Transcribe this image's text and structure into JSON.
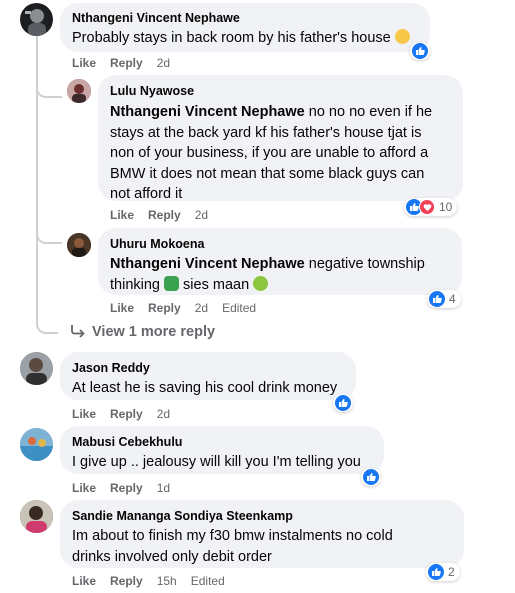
{
  "comments": [
    {
      "name": "Nthangeni Vincent Nephawe",
      "text": "Probably stays in back room by his father's house",
      "emoji": "thinking-face-emoji",
      "actions": {
        "like": "Like",
        "reply": "Reply",
        "time": "2d"
      },
      "reactions": {
        "types": [
          "like"
        ],
        "count": ""
      }
    },
    {
      "name": "Lulu Nyawose",
      "mention": "Nthangeni Vincent Nephawe",
      "lines": [
        "no no no even if he",
        "stays at the back yard kf his father's house tjat is",
        "non of your business, if you are unable to afford a",
        "BMW it does not mean that some black guys can",
        "not afford it"
      ],
      "actions": {
        "like": "Like",
        "reply": "Reply",
        "time": "2d"
      },
      "reactions": {
        "types": [
          "like",
          "love"
        ],
        "count": "10"
      }
    },
    {
      "name": "Uhuru Mokoena",
      "mention": "Nthangeni Vincent Nephawe",
      "line1_rest": "negative township",
      "line2_a": "thinking",
      "line2_b": "sies maan",
      "actions": {
        "like": "Like",
        "reply": "Reply",
        "time": "2d",
        "edited": "Edited"
      },
      "reactions": {
        "types": [
          "like"
        ],
        "count": "4"
      }
    },
    {
      "name": "Jason Reddy",
      "text": "At least he is saving his cool drink money",
      "actions": {
        "like": "Like",
        "reply": "Reply",
        "time": "2d"
      },
      "reactions": {
        "types": [
          "like"
        ],
        "count": ""
      }
    },
    {
      "name": "Mabusi Cebekhulu",
      "text": "I give up .. jealousy will kill you I'm telling you",
      "actions": {
        "like": "Like",
        "reply": "Reply",
        "time": "1d"
      },
      "reactions": {
        "types": [
          "like"
        ],
        "count": ""
      }
    },
    {
      "name": "Sandie Mananga Sondiya Steenkamp",
      "lines": [
        "Im about to finish my f30 bmw instalments no cold",
        "drinks involved only debit order"
      ],
      "actions": {
        "like": "Like",
        "reply": "Reply",
        "time": "15h",
        "edited": "Edited"
      },
      "reactions": {
        "types": [
          "like"
        ],
        "count": "2"
      }
    }
  ],
  "view_more": "View 1 more reply",
  "colors": {
    "like_blue": "#1877f2",
    "love_red": "#f33e58",
    "bubble": "#f0f2f5",
    "muted": "#65676b"
  }
}
